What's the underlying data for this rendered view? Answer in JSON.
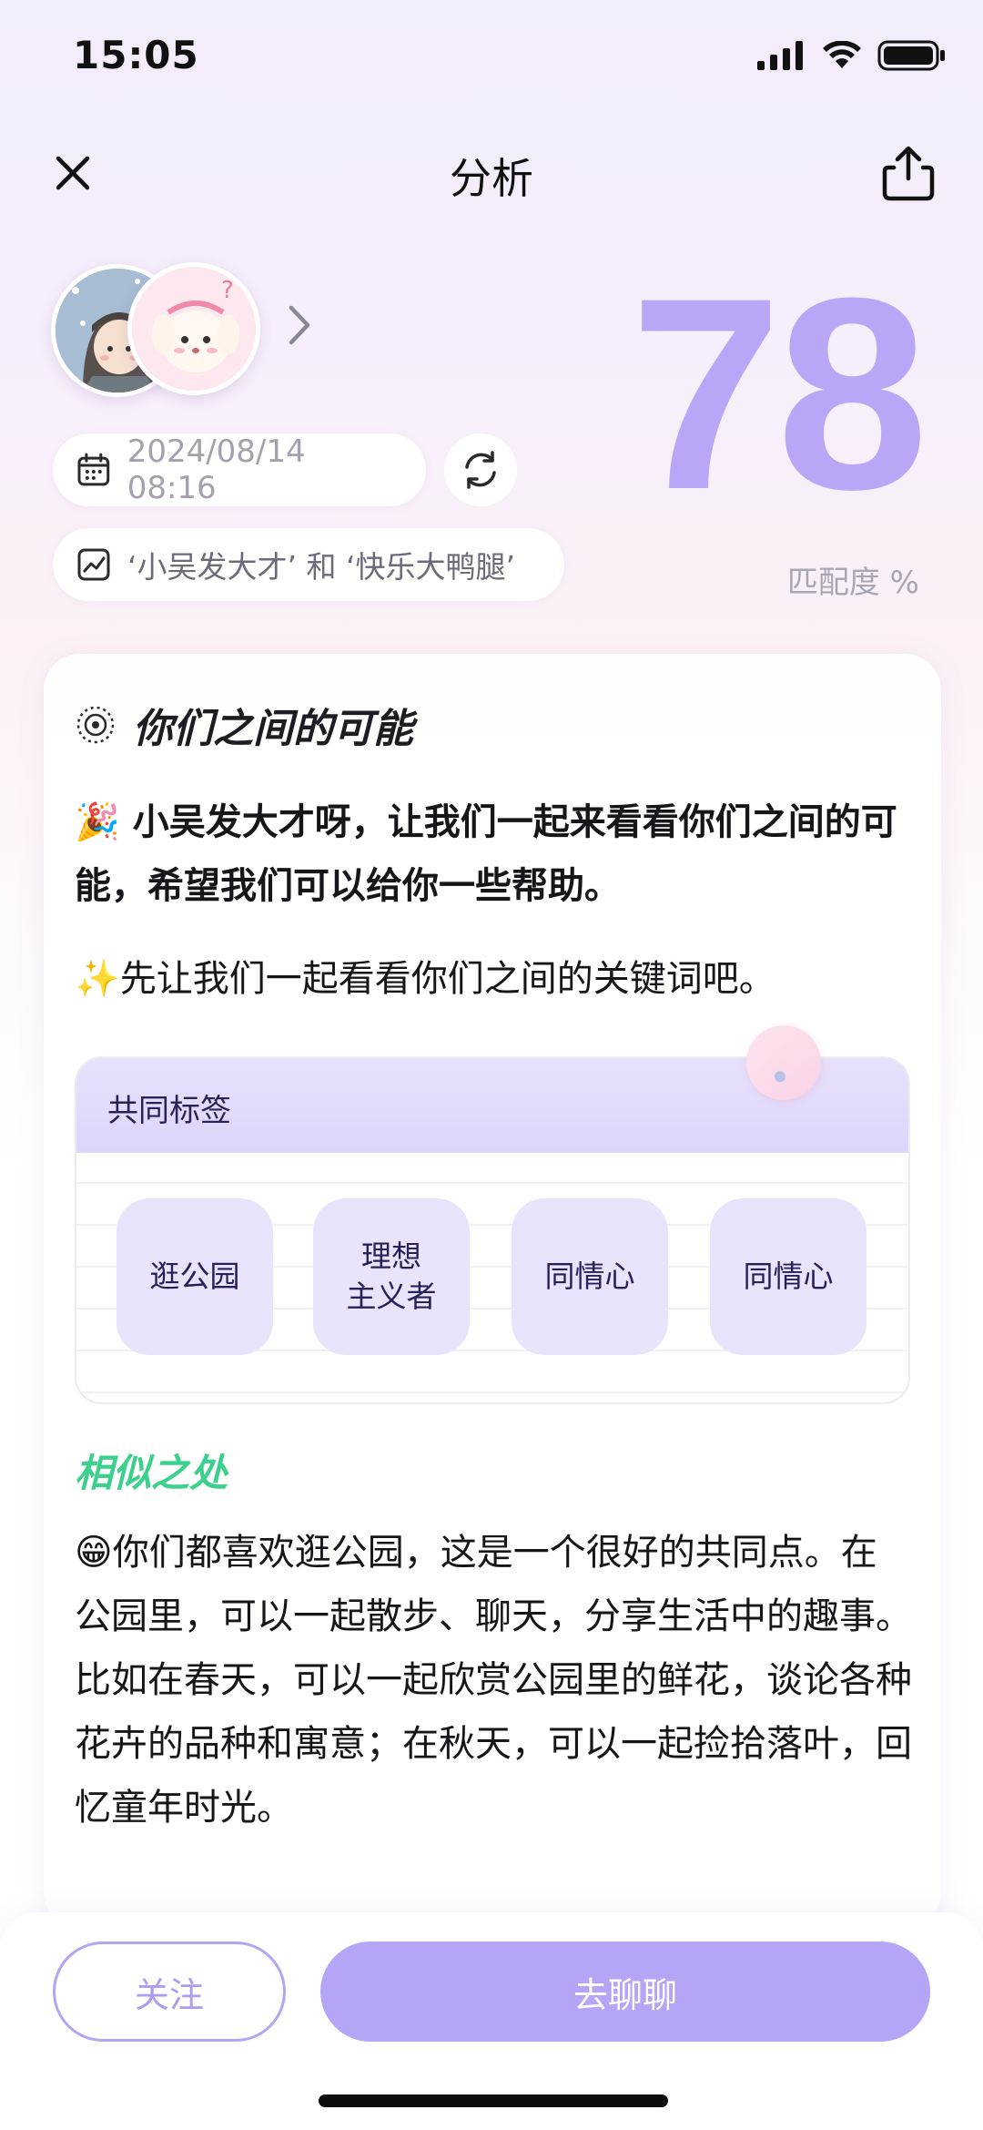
{
  "status_bar": {
    "time": "15:05"
  },
  "nav": {
    "title": "分析"
  },
  "match": {
    "score": "78",
    "score_label": "匹配度 %"
  },
  "meta": {
    "datetime": "2024/08/14 08:16",
    "pair_label": "‘小吴发大才’ 和 ‘快乐大鸭腿’"
  },
  "card": {
    "title": "你们之间的可能",
    "intro_emoji": "🎉",
    "intro_text": "小吴发大才呀，让我们一起来看看你们之间的可能，希望我们可以给你一些帮助。",
    "keywords_emoji": "✨",
    "keywords_text": "先让我们一起看看你们之间的关键词吧。",
    "tags_title": "共同标签",
    "tags": [
      "逛公园",
      "理想\n主义者",
      "同情心",
      "同情心"
    ],
    "similar_title": "相似之处",
    "similar_emoji": "😁",
    "similar_text": "你们都喜欢逛公园，这是一个很好的共同点。在公园里，可以一起散步、聊天，分享生活中的趣事。比如在春天，可以一起欣赏公园里的鲜花，谈论各种花卉的品种和寓意；在秋天，可以一起捡拾落叶，回忆童年时光。"
  },
  "actions": {
    "follow": "关注",
    "chat": "去聊聊"
  },
  "colors": {
    "accent": "#b6a5f7",
    "score": "#b9a6f6",
    "similar": "#3bd08b"
  }
}
